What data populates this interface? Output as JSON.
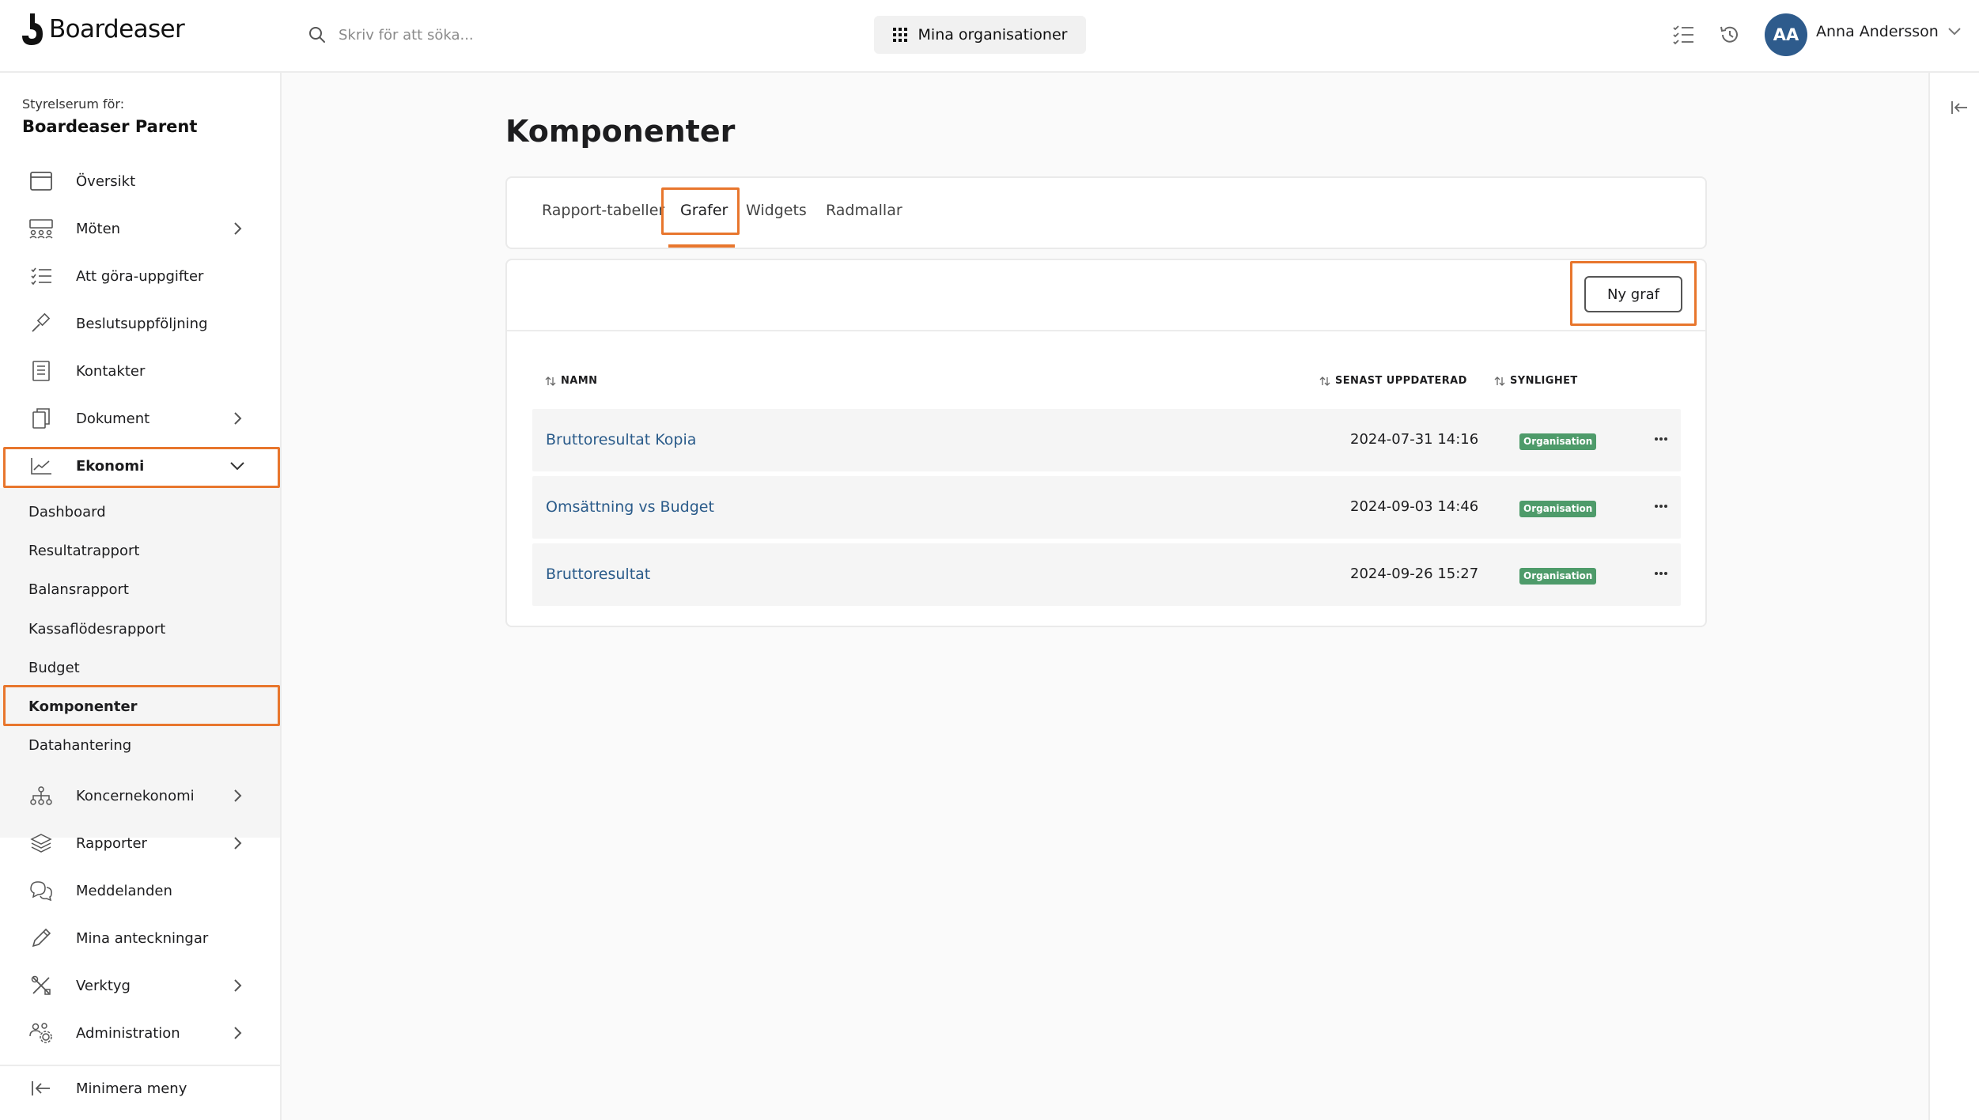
{
  "app": {
    "brand": "Boardeaser"
  },
  "topbar": {
    "search_placeholder": "Skriv för att söka...",
    "orgs_button": "Mina organisationer",
    "user_initials": "AA",
    "user_name": "Anna Andersson"
  },
  "sidebar": {
    "caption": "Styrelserum för:",
    "org_name": "Boardeaser Parent",
    "items": [
      {
        "label": "Översikt",
        "icon": "calendar-icon"
      },
      {
        "label": "Möten",
        "icon": "meeting-icon"
      },
      {
        "label": "Att göra-uppgifter",
        "icon": "checklist-icon"
      },
      {
        "label": "Beslutsuppföljning",
        "icon": "gavel-icon"
      },
      {
        "label": "Kontakter",
        "icon": "contacts-icon"
      },
      {
        "label": "Dokument",
        "icon": "documents-icon"
      },
      {
        "label": "Ekonomi",
        "icon": "chart-line-icon"
      },
      {
        "label": "Koncernekonomi",
        "icon": "org-tree-icon"
      },
      {
        "label": "Rapporter",
        "icon": "layers-icon"
      },
      {
        "label": "Meddelanden",
        "icon": "chat-icon"
      },
      {
        "label": "Mina anteckningar",
        "icon": "pencil-icon"
      },
      {
        "label": "Verktyg",
        "icon": "tools-icon"
      },
      {
        "label": "Administration",
        "icon": "users-gear-icon"
      }
    ],
    "ekonomi_sub": [
      "Dashboard",
      "Resultatrapport",
      "Balansrapport",
      "Kassaflödesrapport",
      "Budget",
      "Komponenter",
      "Datahantering"
    ],
    "minimize": "Minimera meny"
  },
  "main": {
    "title": "Komponenter",
    "tabs": [
      "Rapport-tabeller",
      "Grafer",
      "Widgets",
      "Radmallar"
    ],
    "active_tab": "Grafer",
    "new_button": "Ny graf",
    "columns": {
      "name": "NAMN",
      "updated": "SENAST UPPDATERAD",
      "visibility": "SYNLIGHET"
    },
    "rows": [
      {
        "name": "Bruttoresultat Kopia",
        "updated": "2024-07-31 14:16",
        "visibility": "Organisation"
      },
      {
        "name": "Omsättning vs Budget",
        "updated": "2024-09-03 14:46",
        "visibility": "Organisation"
      },
      {
        "name": "Bruttoresultat",
        "updated": "2024-09-26 15:27",
        "visibility": "Organisation"
      }
    ]
  },
  "colors": {
    "accent_highlight": "#e8762d",
    "link": "#2a5b8a",
    "badge": "#4e9b6a",
    "avatar": "#2e5b8c"
  }
}
